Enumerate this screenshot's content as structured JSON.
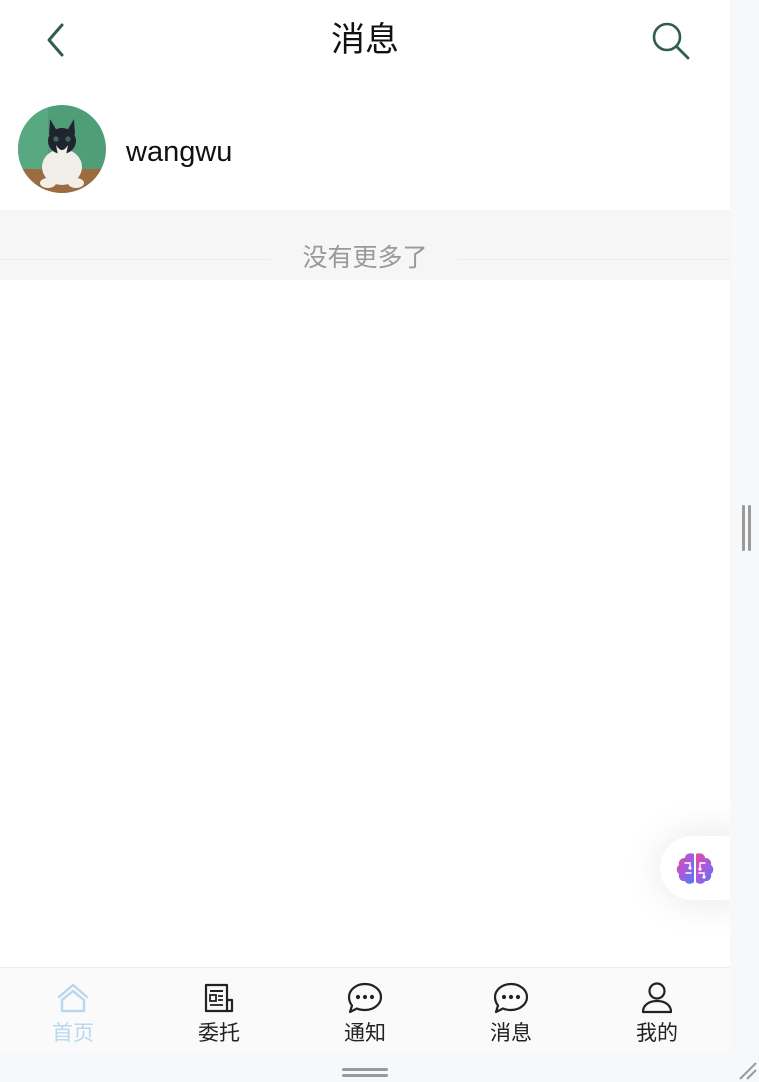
{
  "header": {
    "title": "消息",
    "back_icon": "chevron-left-icon",
    "search_icon": "search-icon"
  },
  "conversations": [
    {
      "name": "wangwu",
      "avatar": "cat-photo-avatar"
    }
  ],
  "list_footer": {
    "text": "没有更多了"
  },
  "fab": {
    "icon": "brain-icon"
  },
  "tabbar": {
    "items": [
      {
        "label": "首页",
        "icon": "home-icon",
        "active": true
      },
      {
        "label": "委托",
        "icon": "document-icon",
        "active": false
      },
      {
        "label": "通知",
        "icon": "chat-bubble-icon",
        "active": false
      },
      {
        "label": "消息",
        "icon": "chat-bubble-icon",
        "active": false
      },
      {
        "label": "我的",
        "icon": "user-icon",
        "active": false
      }
    ]
  },
  "colors": {
    "accent_icon": "#2f5d50",
    "active_tab": "#b8d8ee",
    "muted_text": "#999999"
  }
}
